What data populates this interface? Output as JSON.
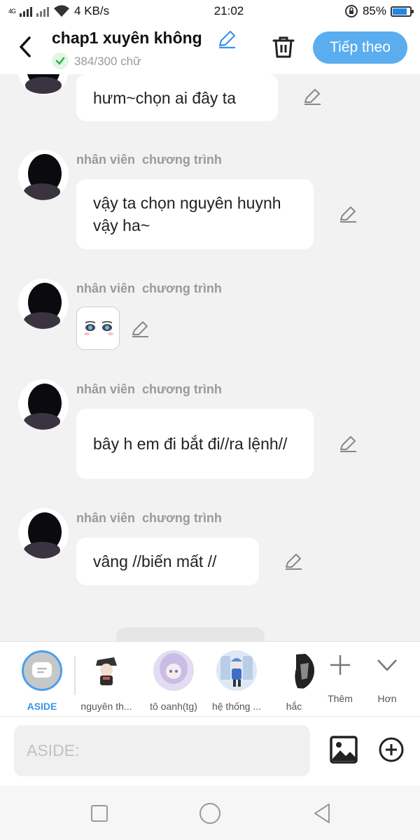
{
  "status_bar": {
    "network": "4G",
    "speed": "4 KB/s",
    "time": "21:02",
    "battery": "85%",
    "battery_level": 0.85,
    "battery_color": "#1e88e5"
  },
  "header": {
    "title": "chap1 xuyên không",
    "word_count": "384/300 chữ",
    "next_label": "Tiếp theo",
    "accent": "#5aadee"
  },
  "messages": [
    {
      "name": "",
      "text": "hưm~chọn ai đây ta",
      "type": "text"
    },
    {
      "name": "nhân viên  chương trình",
      "text": "vậy ta chọn nguyên huynh vậy ha~",
      "type": "text"
    },
    {
      "name": "nhân viên  chương trình",
      "text": "",
      "type": "sticker"
    },
    {
      "name": "nhân viên  chương trình",
      "text": "bây h em đi bắt đi//ra lệnh//",
      "type": "text"
    },
    {
      "name": "nhân viên  chương trình",
      "text": "vâng //biến mất //",
      "type": "text"
    }
  ],
  "characters": {
    "aside_label": "ASIDE",
    "items": [
      {
        "label": "nguyên th..."
      },
      {
        "label": "tô oanh(tg)"
      },
      {
        "label": "hệ thống ..."
      },
      {
        "label": "hắc"
      }
    ],
    "add_label": "Thêm",
    "more_label": "Hơn"
  },
  "input": {
    "placeholder": "ASIDE:"
  }
}
